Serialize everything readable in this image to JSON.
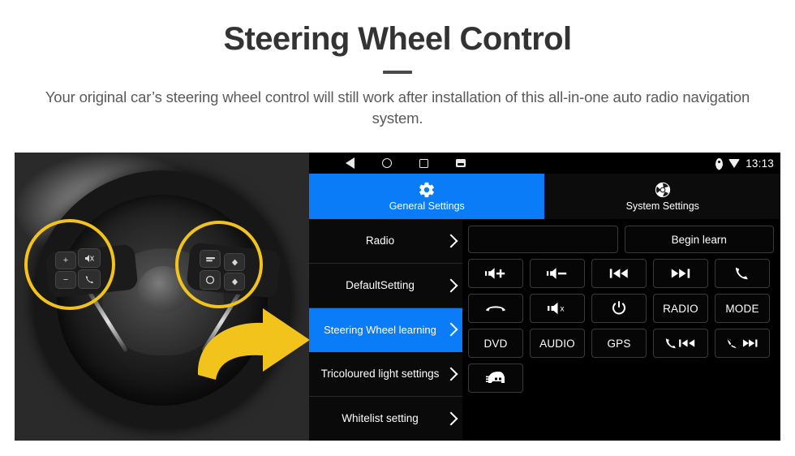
{
  "header": {
    "title": "Steering Wheel Control",
    "subtitle": "Your original car’s steering wheel control will still work after installation of this all-in-one auto radio navigation system."
  },
  "colors": {
    "accent_blue": "#0a7cf7",
    "highlight_yellow": "#f2c41b",
    "panel_black": "#000000",
    "title_gray": "#333333",
    "subtitle_gray": "#5a5a5a"
  },
  "photo": {
    "alt": "Car steering wheel with original steering wheel control buttons highlighted",
    "left_cluster": {
      "name": "volume-and-call-buttons",
      "buttons": [
        "+",
        "mute-speaker",
        "−",
        "call"
      ]
    },
    "right_cluster": {
      "name": "menu-and-navigation-buttons",
      "buttons": [
        "mode",
        "up",
        "circle",
        "down"
      ]
    },
    "arrow": "pointing-right-arrow"
  },
  "android": {
    "statusbar": {
      "nav": [
        {
          "name": "back-icon",
          "label": "back"
        },
        {
          "name": "home-icon",
          "label": "home"
        },
        {
          "name": "recents-icon",
          "label": "recents"
        },
        {
          "name": "screenshot-icon",
          "label": "screenshot"
        }
      ],
      "location_icon": "location-pin-icon",
      "wifi_icon": "wifi-icon",
      "time": "13:13"
    },
    "tabs": [
      {
        "label": "General Settings",
        "icon": "gear-icon",
        "active": true
      },
      {
        "label": "System Settings",
        "icon": "system-logo-icon",
        "active": false
      }
    ],
    "menu": [
      {
        "label": "Radio",
        "active": false
      },
      {
        "label": "DefaultSetting",
        "active": false
      },
      {
        "label": "Steering Wheel learning",
        "active": true
      },
      {
        "label": "Tricoloured light settings",
        "active": false
      },
      {
        "label": "Whitelist setting",
        "active": false
      }
    ],
    "learn_panel": {
      "key_field_value": "",
      "begin_learn_label": "Begin learn",
      "buttons": [
        [
          {
            "name": "volume-up-button",
            "icon": "speaker-plus",
            "label": ""
          },
          {
            "name": "volume-down-button",
            "icon": "speaker-minus",
            "label": ""
          },
          {
            "name": "previous-track-button",
            "icon": "prev-track",
            "label": ""
          },
          {
            "name": "next-track-button",
            "icon": "next-track",
            "label": ""
          },
          {
            "name": "call-answer-button",
            "icon": "phone",
            "label": ""
          }
        ],
        [
          {
            "name": "call-hangup-button",
            "icon": "phone-hangup",
            "label": ""
          },
          {
            "name": "mute-button",
            "icon": "speaker-mute",
            "label": ""
          },
          {
            "name": "power-button",
            "icon": "power",
            "label": ""
          },
          {
            "name": "radio-button",
            "icon": "",
            "label": "RADIO"
          },
          {
            "name": "mode-button",
            "icon": "",
            "label": "MODE"
          }
        ],
        [
          {
            "name": "dvd-button",
            "icon": "",
            "label": "DVD"
          },
          {
            "name": "audio-button",
            "icon": "",
            "label": "AUDIO"
          },
          {
            "name": "gps-button",
            "icon": "",
            "label": "GPS"
          },
          {
            "name": "call-previous-button",
            "icon": "phone-prev",
            "label": ""
          },
          {
            "name": "hangup-next-button",
            "icon": "phone-next",
            "label": ""
          }
        ],
        [
          {
            "name": "car-info-button",
            "icon": "car",
            "label": ""
          }
        ]
      ]
    }
  }
}
